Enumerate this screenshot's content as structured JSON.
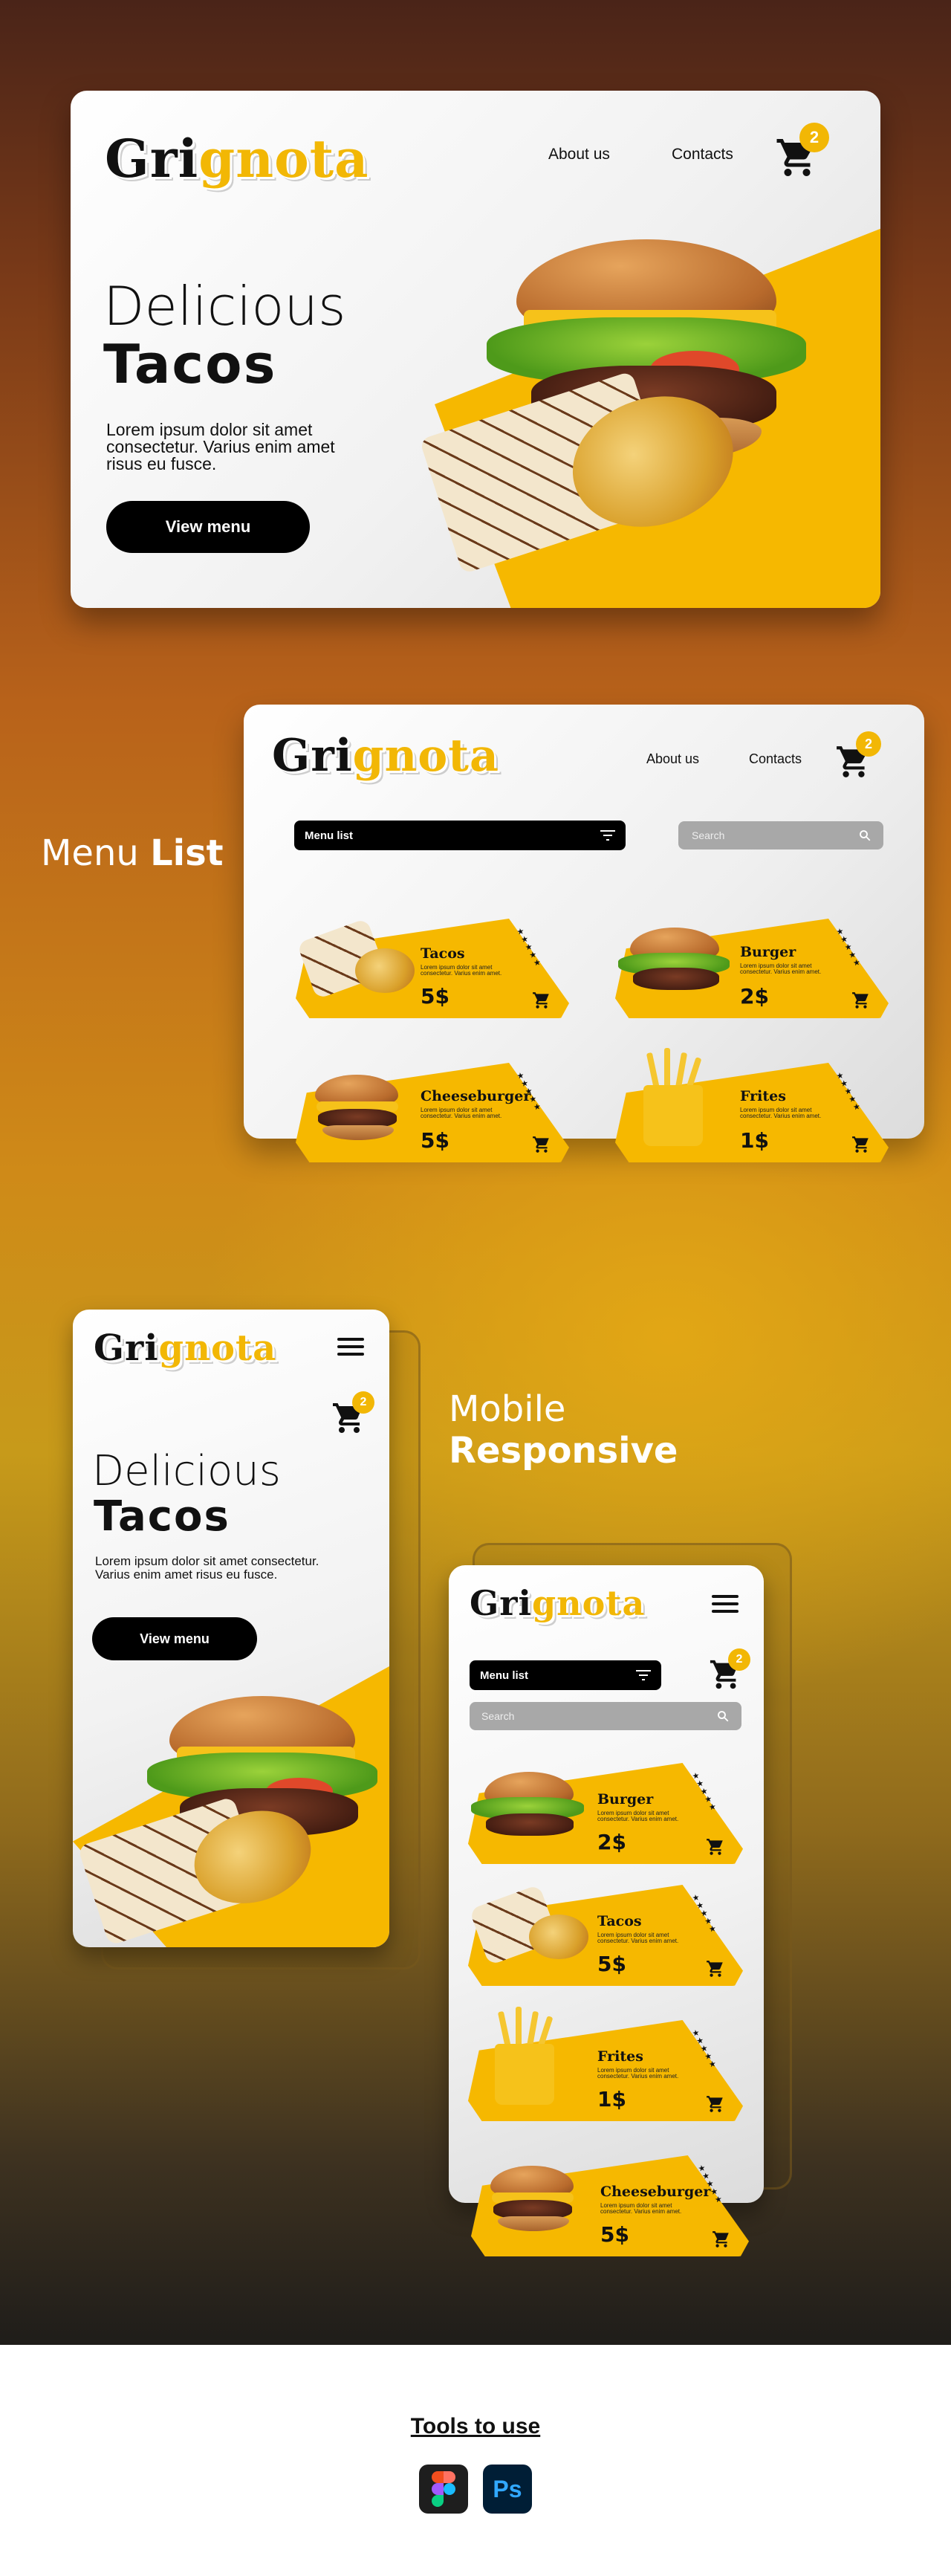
{
  "brand": {
    "logo_part1": "Gri",
    "logo_part2": "gnota"
  },
  "colors": {
    "accent": "#f2b705",
    "tile": "#f6b800",
    "dark": "#000000"
  },
  "desktop": {
    "nav": [
      "About us",
      "Contacts"
    ],
    "cart_count": "2",
    "hero_line1": "Delicious",
    "hero_line2": "Tacos",
    "hero_desc": "Lorem ipsum dolor sit amet consectetur. Varius enim amet risus eu fusce.",
    "cta": "View menu"
  },
  "menu_section": {
    "title_light": "Menu",
    "title_bold": "List",
    "nav": [
      "About us",
      "Contacts"
    ],
    "cart_count": "2",
    "filter_label": "Menu list",
    "search_placeholder": "Search",
    "items": [
      {
        "name": "Tacos",
        "desc": "Lorem ipsum dolor sit amet consectetur. Varius enim amet.",
        "price": "5$",
        "stars": "★★★★★"
      },
      {
        "name": "Burger",
        "desc": "Lorem ipsum dolor sit amet consectetur. Varius enim amet.",
        "price": "2$",
        "stars": "★★★★★"
      },
      {
        "name": "Cheeseburger",
        "desc": "Lorem ipsum dolor sit amet consectetur. Varius enim amet.",
        "price": "5$",
        "stars": "★★★★★"
      },
      {
        "name": "Frites",
        "desc": "Lorem ipsum dolor sit amet consectetur. Varius enim amet.",
        "price": "1$",
        "stars": "★★★★★"
      }
    ]
  },
  "mobile_section": {
    "title_light": "Mobile",
    "title_bold": "Responsive",
    "phone1": {
      "cart_count": "2",
      "hero_line1": "Delicious",
      "hero_line2": "Tacos",
      "hero_desc": "Lorem ipsum dolor sit amet consectetur. Varius enim amet risus eu fusce.",
      "cta": "View menu"
    },
    "phone2": {
      "cart_count": "2",
      "filter_label": "Menu list",
      "search_placeholder": "Search",
      "items": [
        {
          "name": "Burger",
          "desc": "Lorem ipsum dolor sit amet consectetur. Varius enim amet.",
          "price": "2$",
          "stars": "★★★★★"
        },
        {
          "name": "Tacos",
          "desc": "Lorem ipsum dolor sit amet consectetur. Varius enim amet.",
          "price": "5$",
          "stars": "★★★★★"
        },
        {
          "name": "Frites",
          "desc": "Lorem ipsum dolor sit amet consectetur. Varius enim amet.",
          "price": "1$",
          "stars": "★★★★★"
        },
        {
          "name": "Cheeseburger",
          "desc": "Lorem ipsum dolor sit amet consectetur. Varius enim amet.",
          "price": "5$",
          "stars": "★★★★★"
        }
      ]
    }
  },
  "footer": {
    "title": "Tools to use",
    "tools": [
      {
        "name": "Figma",
        "icon": "figma-icon"
      },
      {
        "name": "Ps",
        "icon": "photoshop-icon"
      }
    ]
  }
}
